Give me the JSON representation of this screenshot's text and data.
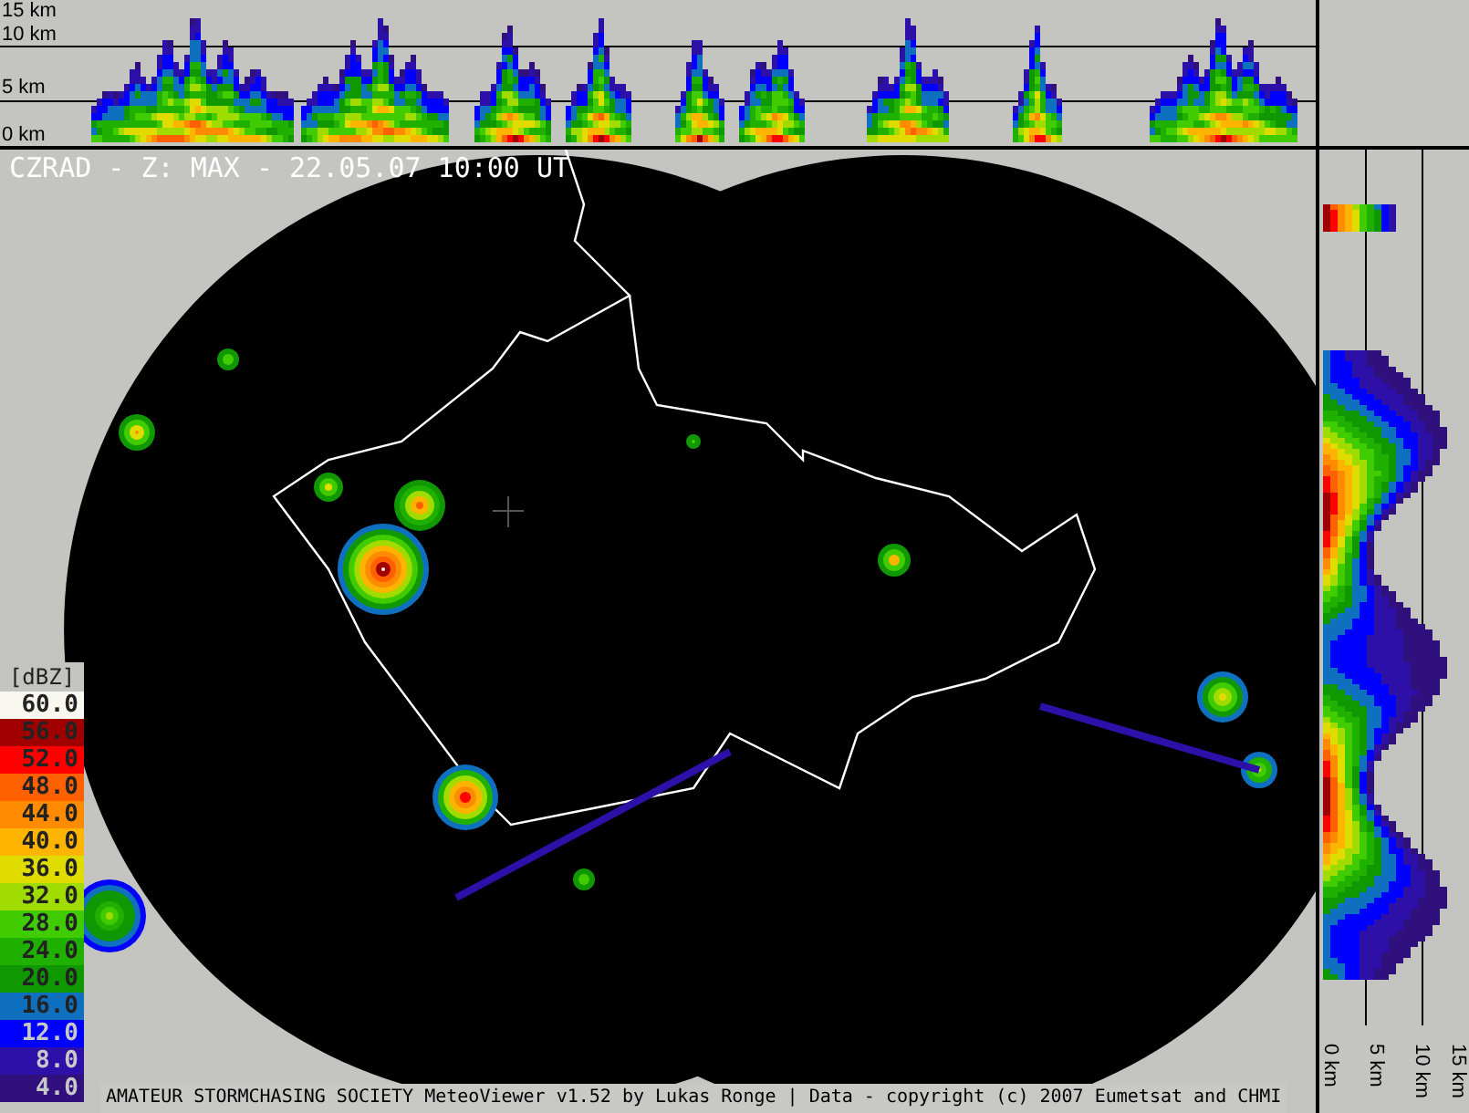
{
  "top_section": {
    "axis_labels": [
      "15 km",
      "10 km",
      "5 km",
      "0 km"
    ]
  },
  "side_section": {
    "axis_labels": [
      "0 km",
      "5 km",
      "10 km",
      "15 km"
    ]
  },
  "map": {
    "title": "CZRAD - Z: MAX - 22.05.07 10:00 UT"
  },
  "legend": {
    "unit": "[dBZ]",
    "items": [
      {
        "label": "60.0",
        "color": "#f8f8f0"
      },
      {
        "label": "56.0",
        "color": "#a00000"
      },
      {
        "label": "52.0",
        "color": "#ff0000"
      },
      {
        "label": "48.0",
        "color": "#ff6000"
      },
      {
        "label": "44.0",
        "color": "#ff8c00"
      },
      {
        "label": "40.0",
        "color": "#ffb400"
      },
      {
        "label": "36.0",
        "color": "#e0dc00"
      },
      {
        "label": "32.0",
        "color": "#a0dc00"
      },
      {
        "label": "28.0",
        "color": "#40cc00"
      },
      {
        "label": "24.0",
        "color": "#20b000"
      },
      {
        "label": "20.0",
        "color": "#109800"
      },
      {
        "label": "16.0",
        "color": "#1070c0"
      },
      {
        "label": "12.0",
        "color": "#0000ff"
      },
      {
        "label": "8.0",
        "color": "#2c10a8"
      },
      {
        "label": "4.0",
        "color": "#30107c"
      }
    ]
  },
  "footer": {
    "text": "AMATEUR STORMCHASING SOCIETY MeteoViewer v1.52 by Lukas Ronge | Data - copyright (c) 2007 Eumetsat and CHMI"
  }
}
